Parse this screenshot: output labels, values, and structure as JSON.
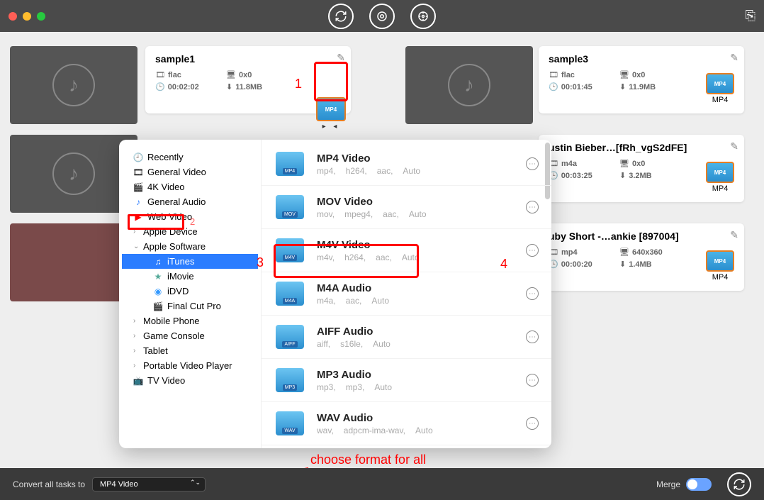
{
  "titlebar": {},
  "cards": {
    "s1": {
      "title": "sample1",
      "format": "flac",
      "res": "0x0",
      "dur": "00:02:02",
      "size": "11.8MB",
      "out": "MP4"
    },
    "s3": {
      "title": "sample3",
      "format": "flac",
      "res": "0x0",
      "dur": "00:01:45",
      "size": "11.9MB",
      "out": "MP4"
    },
    "s4": {
      "title": "ustin Bieber…[fRh_vgS2dFE]",
      "format": "m4a",
      "res": "0x0",
      "dur": "00:03:25",
      "size": "3.2MB",
      "out": "MP4"
    },
    "s5": {
      "title": "uby Short -…ankie [897004]",
      "format": "mp4",
      "res": "640x360",
      "dur": "00:00:20",
      "size": "1.4MB",
      "out": "MP4"
    }
  },
  "sidebar": {
    "recently": "Recently",
    "general_video": "General Video",
    "k4_video": "4K Video",
    "general_audio": "General Audio",
    "web_video": "Web Video",
    "apple_device": "Apple Device",
    "apple_software": "Apple Software",
    "itunes": "iTunes",
    "imovie": "iMovie",
    "idvd": "iDVD",
    "fcp": "Final Cut Pro",
    "mobile": "Mobile Phone",
    "console": "Game Console",
    "tablet": "Tablet",
    "pvp": "Portable Video Player",
    "tv": "TV Video"
  },
  "formats": [
    {
      "title": "MP4 Video",
      "c1": "mp4,",
      "c2": "h264,",
      "c3": "aac,",
      "c4": "Auto",
      "tag": "MP4"
    },
    {
      "title": "MOV Video",
      "c1": "mov,",
      "c2": "mpeg4,",
      "c3": "aac,",
      "c4": "Auto",
      "tag": "MOV"
    },
    {
      "title": "M4V Video",
      "c1": "m4v,",
      "c2": "h264,",
      "c3": "aac,",
      "c4": "Auto",
      "tag": "M4V"
    },
    {
      "title": "M4A Audio",
      "c1": "m4a,",
      "c2": "aac,",
      "c3": "Auto",
      "c4": "",
      "tag": "M4A"
    },
    {
      "title": "AIFF Audio",
      "c1": "aiff,",
      "c2": "s16le,",
      "c3": "Auto",
      "c4": "",
      "tag": "AIFF"
    },
    {
      "title": "MP3 Audio",
      "c1": "mp3,",
      "c2": "mp3,",
      "c3": "Auto",
      "c4": "",
      "tag": "MP3"
    },
    {
      "title": "WAV Audio",
      "c1": "wav,",
      "c2": "adpcm-ima-wav,",
      "c3": "Auto",
      "c4": "",
      "tag": "WAV"
    }
  ],
  "annotations": {
    "n1": "1",
    "n2": "2",
    "n3": "3",
    "n4": "4",
    "choose": "choose format for all"
  },
  "bottom": {
    "label": "Convert all tasks to",
    "selected": "MP4 Video",
    "merge": "Merge"
  }
}
